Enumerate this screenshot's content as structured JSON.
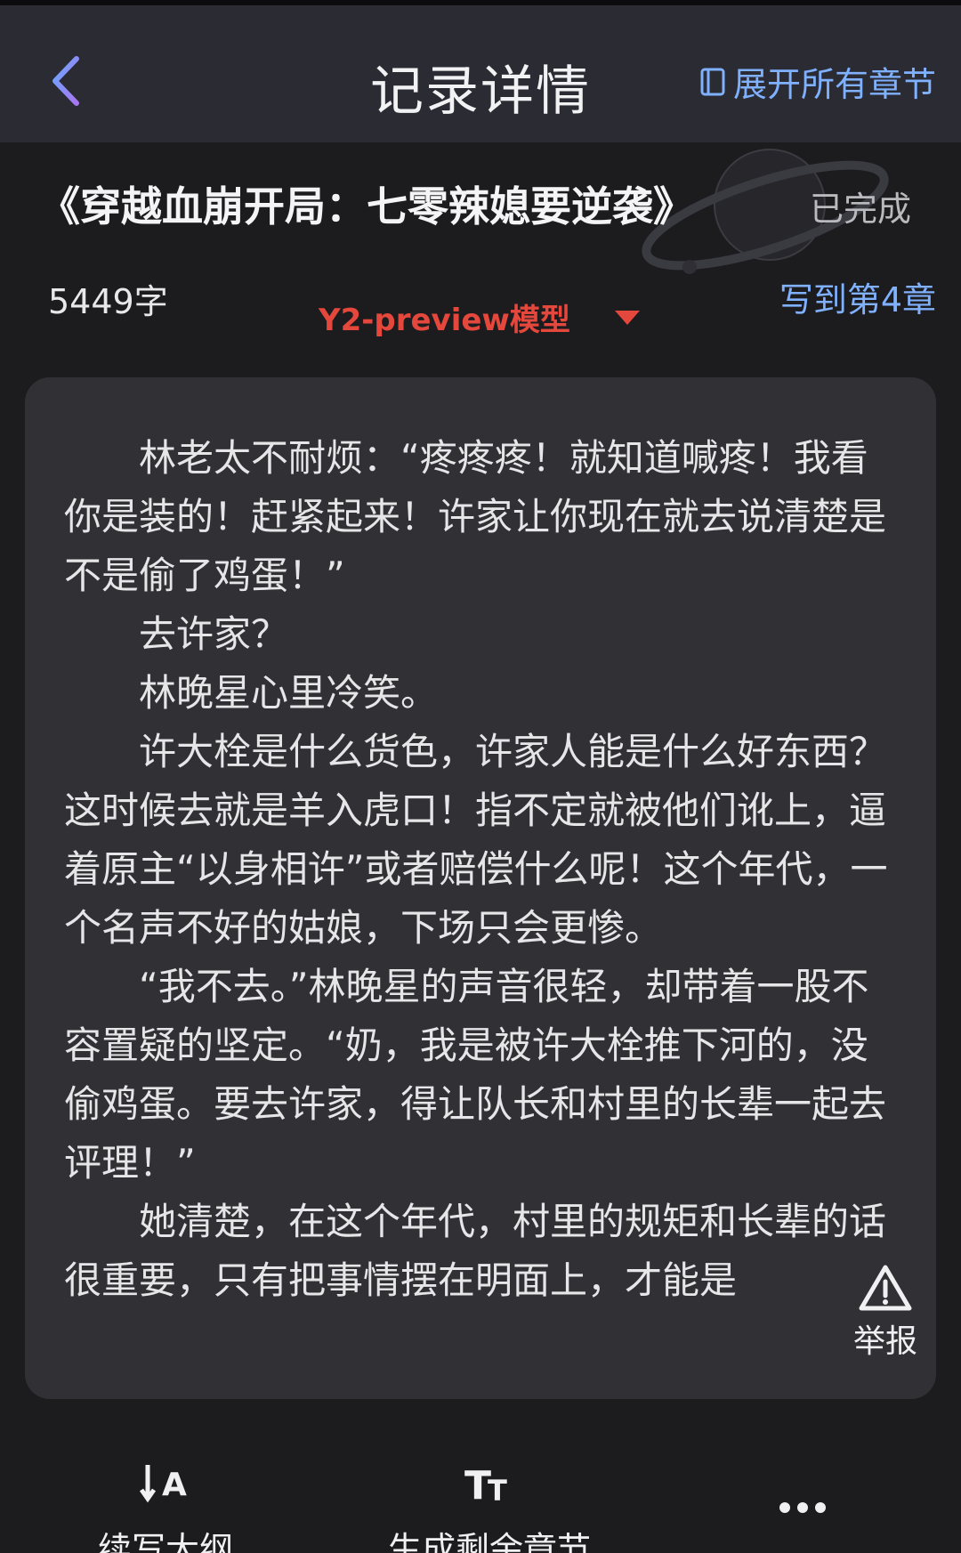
{
  "header": {
    "title": "记录详情",
    "expand_label": "展开所有章节"
  },
  "book": {
    "title": "《穿越血崩开局：七零辣媳要逆袭》",
    "status": "已完成",
    "word_count": "5449字",
    "model": "Y2-preview模型",
    "progress": "写到第4章"
  },
  "content": {
    "paragraphs": [
      "林老太不耐烦：“疼疼疼！就知道喊疼！我看你是装的！赶紧起来！许家让你现在就去说清楚是不是偷了鸡蛋！”",
      "去许家？",
      "林晚星心里冷笑。",
      "许大栓是什么货色，许家人能是什么好东西？这时候去就是羊入虎口！指不定就被他们讹上，逼着原主“以身相许”或者赔偿什么呢！这个年代，一个名声不好的姑娘，下场只会更惨。",
      "“我不去。”林晚星的声音很轻，却带着一股不容置疑的坚定。“奶，我是被许大栓推下河的，没偷鸡蛋。要去许家，得让队长和村里的长辈一起去评理！”",
      "她清楚，在这个年代，村里的规矩和长辈的话很重要，只有把事情摆在明面上，才能是"
    ]
  },
  "report": {
    "label": "举报"
  },
  "bottom_bar": {
    "outline_label": "续写大纲",
    "generate_label": "生成剩余章节"
  },
  "colors": {
    "accent_blue": "#7fb1ff",
    "model_red": "#e4473c",
    "back_purple": "#8c7cf5"
  }
}
